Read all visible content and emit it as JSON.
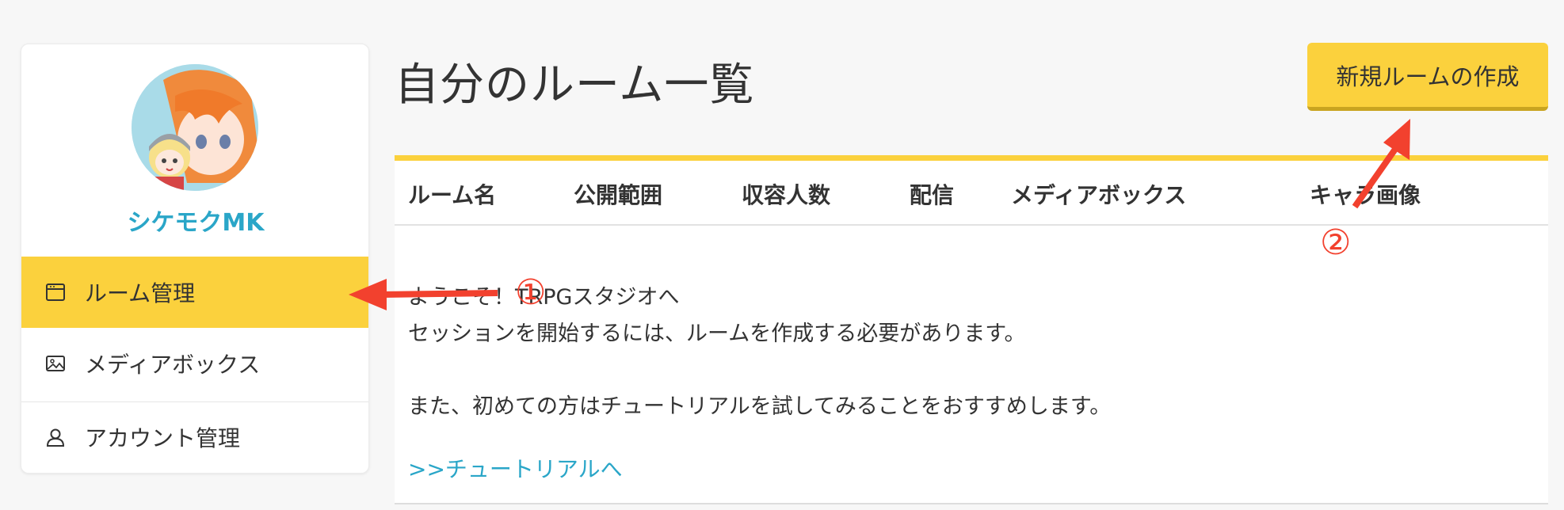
{
  "sidebar": {
    "username": "シケモクMK",
    "items": [
      {
        "label": "ルーム管理",
        "icon": "window-icon",
        "active": true
      },
      {
        "label": "メディアボックス",
        "icon": "image-icon",
        "active": false
      },
      {
        "label": "アカウント管理",
        "icon": "user-icon",
        "active": false
      }
    ]
  },
  "main": {
    "title": "自分のルーム一覧",
    "create_button": "新規ルームの作成",
    "table": {
      "columns": [
        "ルーム名",
        "公開範囲",
        "収容人数",
        "配信",
        "メディアボックス",
        "キャラ画像"
      ]
    },
    "welcome": {
      "line1": "ようこそ！TRPGスタジオへ",
      "line2": "セッションを開始するには、ルームを作成する必要があります。",
      "line3": "また、初めての方はチュートリアルを試してみることをおすすめします。",
      "link": ">>チュートリアルへ"
    }
  },
  "annotations": {
    "marker1": "①",
    "marker2": "②",
    "color": "#f2412e"
  },
  "colors": {
    "accent": "#fbd13d",
    "link": "#2aa6c8",
    "annotation": "#f2412e"
  }
}
